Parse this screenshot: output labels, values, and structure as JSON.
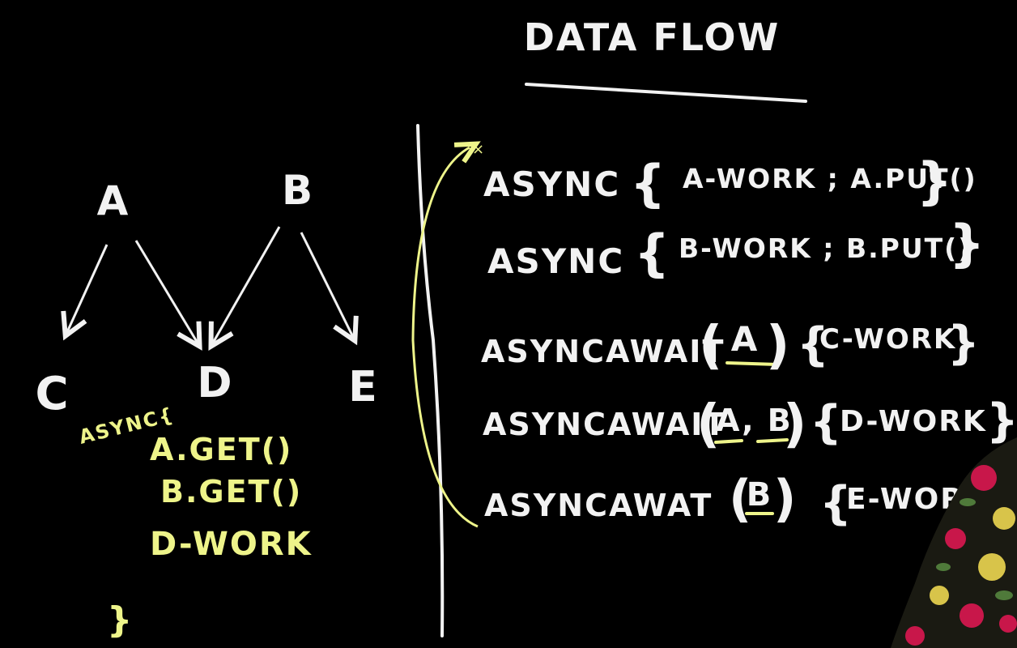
{
  "title": "DATA FLOW",
  "graph": {
    "nodes": [
      "A",
      "B",
      "C",
      "D",
      "E"
    ]
  },
  "async_block": {
    "keyword": "ASYNC{",
    "lines": [
      "A.GET()",
      "B.GET()",
      "D-WORK"
    ],
    "closing": "}"
  },
  "statements": [
    {
      "keyword": "ASYNC",
      "open": "{",
      "body": "A-WORK ; A.PUT()",
      "close": "}"
    },
    {
      "keyword": "ASYNC",
      "open": "{",
      "body": "B-WORK ; B.PUT()",
      "close": "}"
    },
    {
      "keyword": "ASYNCAWAIT",
      "args_open": "(",
      "args": "A",
      "args_close": ")",
      "open": "{",
      "body": "C-WORK",
      "close": "}"
    },
    {
      "keyword": "ASYNCAWAIT",
      "args_open": "(",
      "args": "A, B",
      "args_close": ")",
      "open": "{",
      "body": "D-WORK",
      "close": "}"
    },
    {
      "keyword": "ASYNCAWAT",
      "args_open": "(",
      "args": "B",
      "args_close": ")",
      "open": "{",
      "body": "E-WORK",
      "close": "}"
    }
  ],
  "colors": {
    "chalk_white": "#f2f2f2",
    "chalk_yellow": "#eef48a",
    "background": "#000000",
    "shirt_red": "#c8174a",
    "shirt_yellow": "#d8c44a",
    "shirt_dark": "#1a1a12"
  },
  "icons": [
    "arrow-icon",
    "bracket-icon",
    "person-shoulder"
  ]
}
